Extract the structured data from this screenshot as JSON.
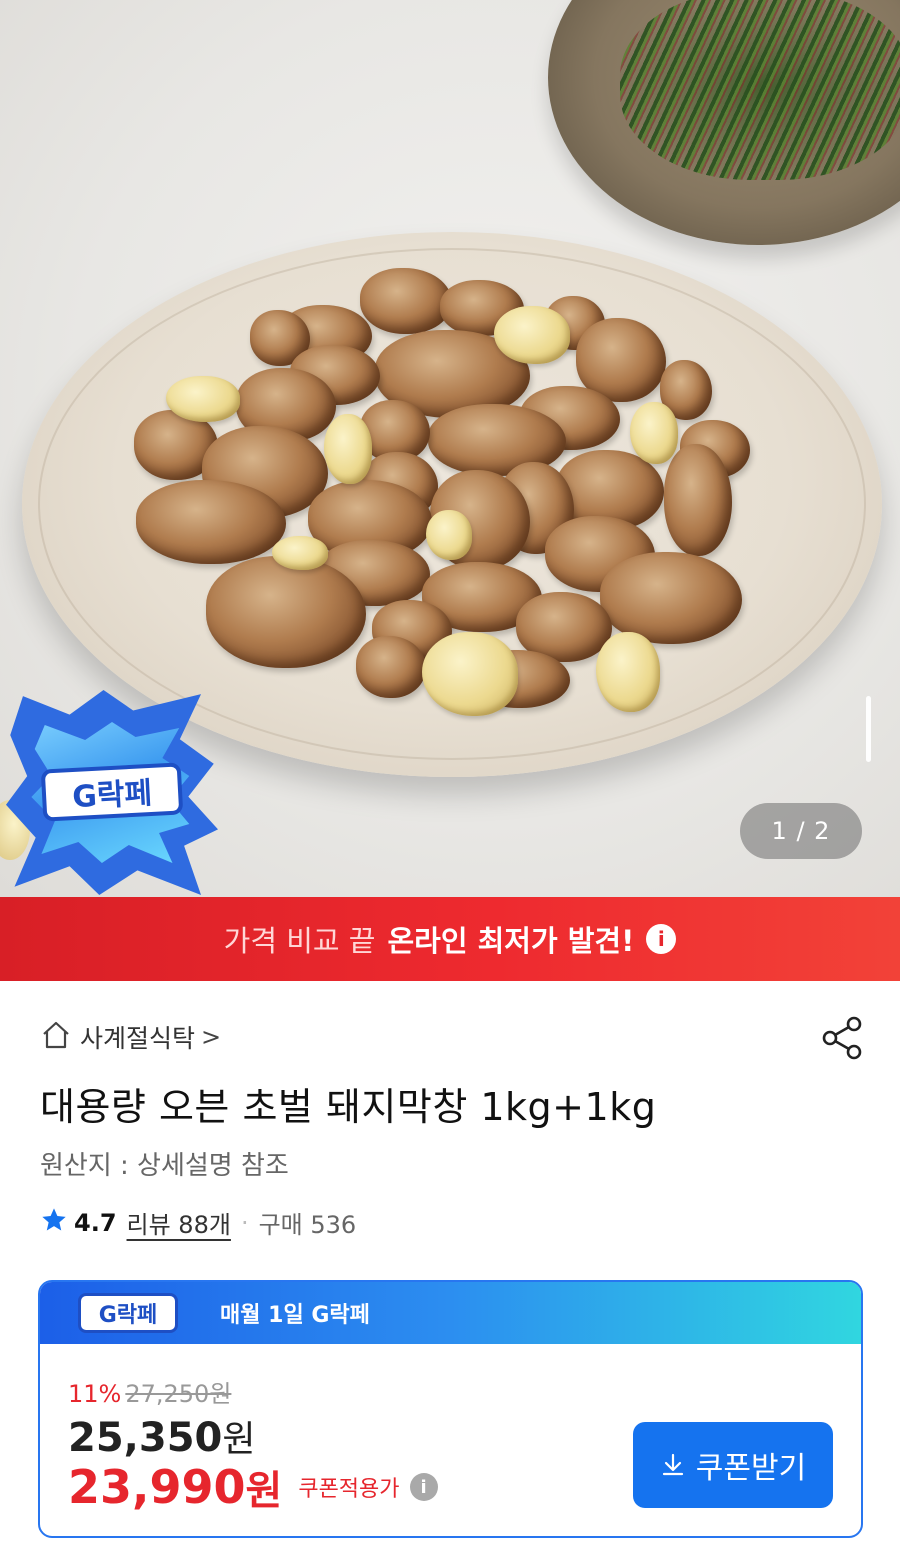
{
  "hero": {
    "page_counter": "1 / 2",
    "badge_label": "G락페"
  },
  "banner": {
    "text_light": "가격 비교 끝",
    "text_bold": "온라인 최저가 발견!",
    "info_icon": "info-icon"
  },
  "store": {
    "name": "사계절식탁",
    "chevron": ">",
    "icon": "home-icon"
  },
  "product": {
    "title": "대용량 오븐 초벌 돼지막창 1kg+1kg",
    "origin": "원산지 : 상세설명 참조",
    "rating": "4.7",
    "review": "리뷰 88개",
    "separator": "·",
    "purchases": "구매 536"
  },
  "coupon": {
    "badge_label": "G락페",
    "header_text": "매월 1일 G락페",
    "discount_pct": "11%",
    "original_price": "27,250원",
    "price_amount": "25,350",
    "price_unit": "원",
    "final_amount": "23,990",
    "final_unit": "원",
    "final_tag": "쿠폰적용가",
    "button_label": "쿠폰받기"
  },
  "colors": {
    "banner_red": "#e6262d",
    "accent_blue": "#1573ef",
    "star": "#1573ef"
  }
}
